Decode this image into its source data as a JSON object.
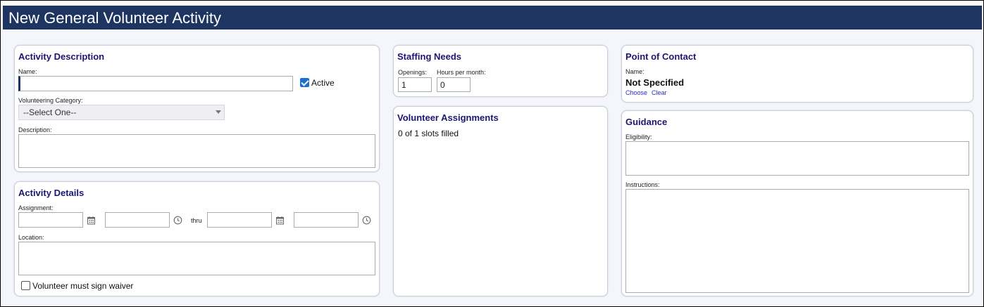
{
  "page": {
    "title": "New General Volunteer Activity"
  },
  "activity_description": {
    "heading": "Activity Description",
    "name_label": "Name:",
    "name_value": "",
    "active_label": "Active",
    "active_checked": true,
    "category_label": "Volunteering Category:",
    "category_selected": "--Select One--",
    "description_label": "Description:",
    "description_value": ""
  },
  "activity_details": {
    "heading": "Activity Details",
    "assignment_label": "Assignment:",
    "thru_label": "thru",
    "start_date": "",
    "start_time": "",
    "end_date": "",
    "end_time": "",
    "location_label": "Location:",
    "location_value": "",
    "waiver_label": "Volunteer must sign waiver",
    "waiver_checked": false
  },
  "staffing_needs": {
    "heading": "Staffing Needs",
    "openings_label": "Openings:",
    "openings_value": "1",
    "hours_label": "Hours per month:",
    "hours_value": "0"
  },
  "volunteer_assignments": {
    "heading": "Volunteer Assignments",
    "status": "0 of 1 slots filled"
  },
  "point_of_contact": {
    "heading": "Point of Contact",
    "name_label": "Name:",
    "name_value": "Not Specified",
    "choose_link": "Choose",
    "clear_link": "Clear"
  },
  "guidance": {
    "heading": "Guidance",
    "eligibility_label": "Eligibility:",
    "eligibility_value": "",
    "instructions_label": "Instructions:",
    "instructions_value": ""
  },
  "colors": {
    "title_bar": "#1f3561",
    "heading_text": "#1c1670",
    "checkbox_accent": "#1f6fd1",
    "link": "#2a2ad0"
  },
  "icons": {
    "date_picker": "calendar-icon",
    "time_picker": "clock-icon"
  }
}
